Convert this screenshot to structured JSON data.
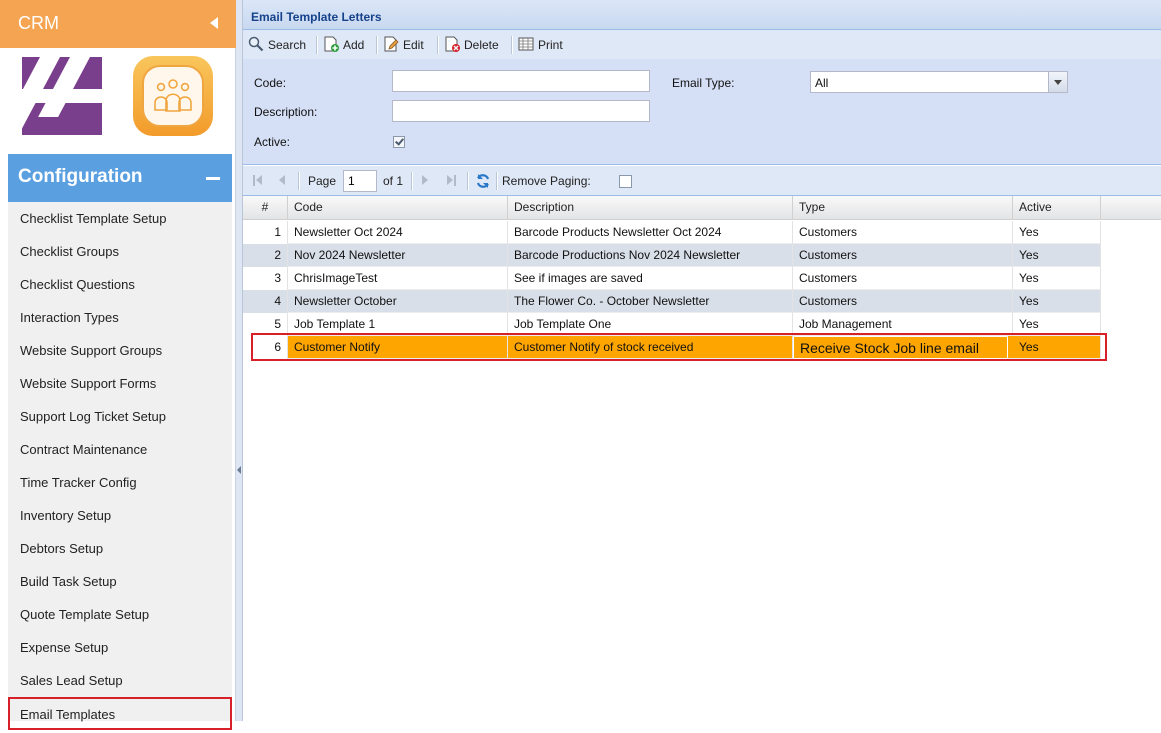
{
  "app": {
    "title": "CRM"
  },
  "sidebar": {
    "section_title": "Configuration",
    "items": [
      {
        "label": "Checklist Template Setup"
      },
      {
        "label": "Checklist Groups"
      },
      {
        "label": "Checklist Questions"
      },
      {
        "label": "Interaction Types"
      },
      {
        "label": "Website Support Groups"
      },
      {
        "label": "Website Support Forms"
      },
      {
        "label": "Support Log Ticket Setup"
      },
      {
        "label": "Contract Maintenance"
      },
      {
        "label": "Time Tracker Config"
      },
      {
        "label": "Inventory Setup"
      },
      {
        "label": "Debtors Setup"
      },
      {
        "label": "Build Task Setup"
      },
      {
        "label": "Quote Template Setup"
      },
      {
        "label": "Expense Setup"
      },
      {
        "label": "Sales Lead Setup"
      },
      {
        "label": "Email Templates"
      }
    ],
    "active_item": "Email Templates"
  },
  "panel": {
    "title": "Email Template Letters"
  },
  "toolbar": {
    "search": "Search",
    "add": "Add",
    "edit": "Edit",
    "delete": "Delete",
    "print": "Print"
  },
  "filters": {
    "code_label": "Code:",
    "code_value": "",
    "description_label": "Description:",
    "description_value": "",
    "active_label": "Active:",
    "active_checked": true,
    "email_type_label": "Email Type:",
    "email_type_value": "All"
  },
  "paging": {
    "page_label": "Page",
    "page_value": "1",
    "of_label": "of 1",
    "remove_paging_label": "Remove Paging:",
    "remove_paging_checked": false
  },
  "grid": {
    "columns": [
      "#",
      "Code",
      "Description",
      "Type",
      "Active"
    ],
    "rows": [
      {
        "num": "1",
        "code": "Newsletter Oct 2024",
        "description": "Barcode Products Newsletter Oct 2024",
        "type": "Customers",
        "active": "Yes"
      },
      {
        "num": "2",
        "code": "Nov 2024 Newsletter",
        "description": "Barcode Productions Nov 2024 Newsletter",
        "type": "Customers",
        "active": "Yes"
      },
      {
        "num": "3",
        "code": "ChrisImageTest",
        "description": "See if images are saved",
        "type": "Customers",
        "active": "Yes"
      },
      {
        "num": "4",
        "code": "Newsletter October",
        "description": "The Flower Co. - October Newsletter",
        "type": "Customers",
        "active": "Yes"
      },
      {
        "num": "5",
        "code": "Job Template 1",
        "description": "Job Template One",
        "type": "Job Management",
        "active": "Yes"
      },
      {
        "num": "6",
        "code": "Customer Notify",
        "description": "Customer Notify of stock received",
        "type": "Receive Stock Job line email",
        "active": "Yes"
      }
    ],
    "selected_row": 6
  },
  "colors": {
    "crm_header": "#f5a452",
    "config_header": "#5a9fe0",
    "selected_row": "#ffa500",
    "highlight_border": "#d8202a",
    "panel_title_text": "#15428b"
  }
}
